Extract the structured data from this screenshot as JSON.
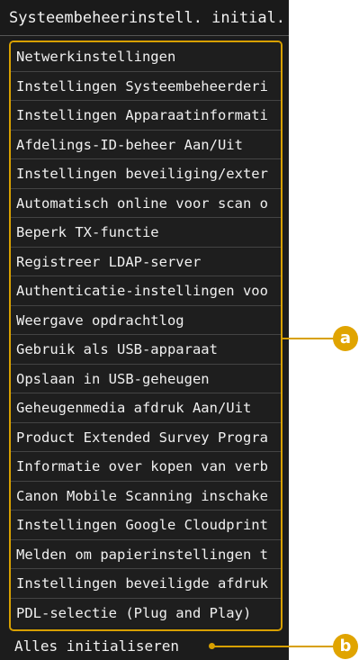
{
  "title": "Systeembeheerinstell. initial.",
  "items": [
    "Netwerkinstellingen",
    "Instellingen Systeembeheerderi",
    "Instellingen Apparaatinformati",
    "Afdelings-ID-beheer Aan/Uit",
    "Instellingen beveiliging/exter",
    "Automatisch online voor scan o",
    "Beperk TX-functie",
    "Registreer LDAP-server",
    "Authenticatie-instellingen voo",
    "Weergave opdrachtlog",
    "Gebruik als USB-apparaat",
    "Opslaan in USB-geheugen",
    "Geheugenmedia afdruk Aan/Uit",
    "Product Extended Survey Progra",
    "Informatie over kopen van verb",
    "Canon Mobile Scanning inschake",
    "Instellingen Google Cloudprint",
    "Melden om papierinstellingen t",
    "Instellingen beveiligde afdruk",
    "PDL-selectie (Plug and Play)"
  ],
  "bottom_item": "Alles initialiseren",
  "callouts": {
    "a": "a",
    "b": "b"
  },
  "colors": {
    "accent": "#d8a000",
    "panel": "#1c1c1c",
    "text": "#f0f0f0"
  }
}
